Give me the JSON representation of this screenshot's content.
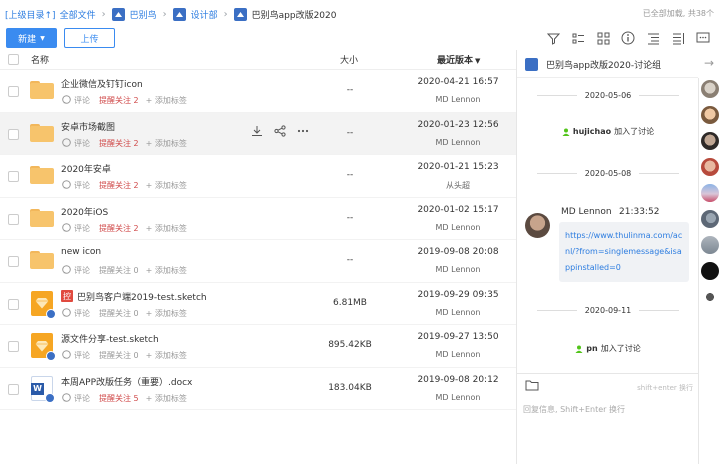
{
  "breadcrumb": {
    "up": "[上级目录↑]",
    "all_files": "全部文件",
    "level1": "巴别鸟",
    "level2": "设计部",
    "current": "巴别鸟app改版2020",
    "loaded_status": "已全部加载, 共38个"
  },
  "toolbar": {
    "new_label": "新建",
    "upload_label": "上传",
    "icons": [
      "filter-icon",
      "list-view-icon",
      "grid-view-icon",
      "info-icon",
      "sort-icon",
      "detail-list-icon",
      "chat-icon"
    ]
  },
  "list_header": {
    "name": "名称",
    "size": "大小",
    "version": "最近版本"
  },
  "files": [
    {
      "name": "企业微信及钉钉icon",
      "type": "folder",
      "comment": "评论",
      "remind": "提醒关注 2",
      "add_tag": "添加标签",
      "size": "--",
      "date": "2020-04-21 16:57",
      "user": "MD Lennon"
    },
    {
      "name": "安卓市场截图",
      "type": "folder",
      "comment": "评论",
      "remind": "提醒关注 2",
      "add_tag": "添加标签",
      "size": "--",
      "date": "2020-01-23 12:56",
      "user": "MD Lennon"
    },
    {
      "name": "2020年安卓",
      "type": "folder",
      "comment": "评论",
      "remind": "提醒关注 2",
      "add_tag": "添加标签",
      "size": "--",
      "date": "2020-01-21 15:23",
      "user": "从头超"
    },
    {
      "name": "2020年iOS",
      "type": "folder",
      "comment": "评论",
      "remind": "提醒关注 2",
      "add_tag": "添加标签",
      "size": "--",
      "date": "2020-01-02 15:17",
      "user": "MD Lennon"
    },
    {
      "name": "new icon",
      "type": "folder",
      "comment": "评论",
      "remind": "提醒关注 0",
      "add_tag": "添加标签",
      "size": "--",
      "date": "2019-09-08 20:08",
      "user": "MD Lennon"
    },
    {
      "name": "巴别鸟客户端2019-test.sketch",
      "type": "sketch",
      "lock_tag": "控",
      "comment": "评论",
      "remind": "提醒关注 0",
      "add_tag": "添加标签",
      "size": "6.81MB",
      "date": "2019-09-29 09:35",
      "user": "MD Lennon"
    },
    {
      "name": "源文件分享-test.sketch",
      "type": "sketch",
      "comment": "评论",
      "remind": "提醒关注 0",
      "add_tag": "添加标签",
      "size": "895.42KB",
      "date": "2019-09-27 13:50",
      "user": "MD Lennon"
    },
    {
      "name": "本周APP改版任务（重要）.docx",
      "type": "docx",
      "comment": "评论",
      "remind": "提醒关注 5",
      "add_tag": "添加标签",
      "size": "183.04KB",
      "date": "2019-09-08 20:12",
      "user": "MD Lennon"
    }
  ],
  "chat": {
    "title": "巴别鸟app改版2020-讨论组",
    "date1": "2020-05-06",
    "join1_user": "hujichao",
    "join1_text": "加入了讨论",
    "date2": "2020-05-08",
    "msg_user": "MD Lennon",
    "msg_time": "21:33:52",
    "msg_link": "https://www.thulinma.com/acnl/?from=singlemessage&isappinstalled=0",
    "date3": "2020-09-11",
    "join2_user": "pn",
    "join2_text": "加入了讨论",
    "input_hint": "shift+enter 换行",
    "input_placeholder": "回复信息, Shift+Enter 换行"
  },
  "colors": {
    "accent": "#3a8bf0",
    "link": "#2d7de0",
    "remind_red": "#d04b4b",
    "folder": "#f7c46c"
  }
}
